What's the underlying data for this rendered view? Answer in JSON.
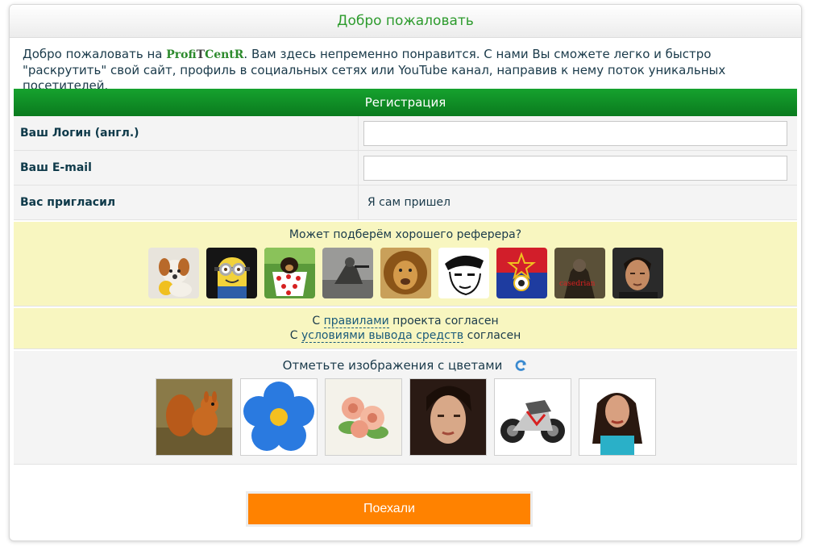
{
  "header": {
    "title": "Добро пожаловать"
  },
  "intro": {
    "before": "Добро пожаловать на ",
    "brand_a": "Profi",
    "brand_b": "T",
    "brand_c": "CentR",
    "after": ". Вам здесь непременно понравится. С нами Вы сможете легко и быстро \"раскрутить\" свой сайт, профиль в социальных сетях или YouTube канал, направив к нему поток уникальных посетителей."
  },
  "registration": {
    "title": "Регистрация",
    "login_label": "Ваш Логин (англ.)",
    "login_value": "",
    "email_label": "Ваш E-mail",
    "email_value": "",
    "referrer_label": "Вас пригласил",
    "referrer_value": "Я сам пришел"
  },
  "referrers": {
    "title": "Может подберём хорошего реферера?",
    "avatars": [
      "dog-avatar",
      "minion-avatar",
      "puppy-cup-avatar",
      "soldier-avatar",
      "lion-avatar",
      "sketch-face-avatar",
      "cska-logo-avatar",
      "warrior-avatar",
      "man-portrait-avatar"
    ],
    "avatar_caption": "casedrian"
  },
  "rules": {
    "line1_before": "С ",
    "line1_link": "правилами",
    "line1_after": " проекта согласен",
    "line2_before": "С ",
    "line2_link": "условиями вывода средств",
    "line2_after": " согласен"
  },
  "captcha": {
    "title": "Отметьте изображения с цветами",
    "images": [
      "squirrel-image",
      "blue-flower-image",
      "roses-image",
      "woman-face-image",
      "motorcycle-image",
      "woman-portrait-image"
    ]
  },
  "submit": {
    "label": "Поехали"
  },
  "colors": {
    "accent_green": "#0a8a22",
    "button_orange": "#ff8200",
    "ref_bg": "#f8f6c0"
  }
}
